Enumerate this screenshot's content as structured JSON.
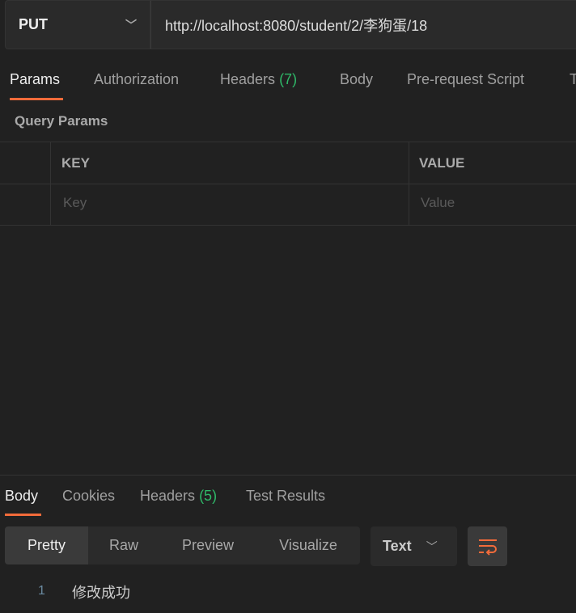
{
  "request": {
    "method": "PUT",
    "url": "http://localhost:8080/student/2/李狗蛋/18"
  },
  "tabs": [
    {
      "label": "Params"
    },
    {
      "label": "Authorization"
    },
    {
      "label": "Headers",
      "count": "(7)"
    },
    {
      "label": "Body"
    },
    {
      "label": "Pre-request Script"
    },
    {
      "label": "T"
    }
  ],
  "query_params": {
    "title": "Query Params",
    "key_header": "KEY",
    "value_header": "VALUE",
    "key_placeholder": "Key",
    "value_placeholder": "Value"
  },
  "response": {
    "tabs": [
      {
        "label": "Body"
      },
      {
        "label": "Cookies"
      },
      {
        "label": "Headers",
        "count": "(5)"
      },
      {
        "label": "Test Results"
      }
    ],
    "views": [
      "Pretty",
      "Raw",
      "Preview",
      "Visualize"
    ],
    "format": "Text",
    "lines": [
      {
        "num": "1",
        "text": "修改成功"
      }
    ]
  },
  "colors": {
    "accent": "#f26b3a",
    "count_green": "#2fb868",
    "background": "#212121"
  }
}
